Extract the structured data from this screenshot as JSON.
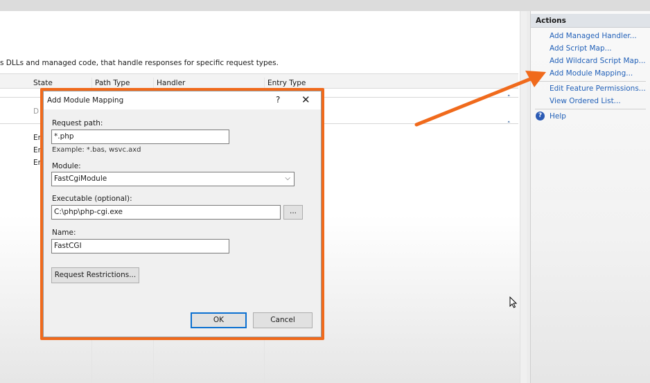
{
  "main": {
    "description": "s DLLs and managed code, that handle responses for specific request types.",
    "columns": [
      "State",
      "Path Type",
      "Handler",
      "Entry Type"
    ],
    "faded_row": "D",
    "rows": [
      "Er",
      "Er",
      "Er"
    ]
  },
  "actions": {
    "title": "Actions",
    "items": [
      "Add Managed Handler...",
      "Add Script Map...",
      "Add Wildcard Script Map...",
      "Add Module Mapping...",
      "Edit Feature Permissions...",
      "View Ordered List...",
      "Help"
    ]
  },
  "dialog": {
    "title": "Add Module Mapping",
    "help_glyph": "?",
    "close_glyph": "✕",
    "request_path_label": "Request path:",
    "request_path_value": "*.php",
    "request_path_hint": "Example: *.bas, wsvc.axd",
    "module_label": "Module:",
    "module_value": "FastCgiModule",
    "executable_label": "Executable (optional):",
    "executable_value": "C:\\php\\php-cgi.exe",
    "browse_label": "...",
    "name_label": "Name:",
    "name_value": "FastCGI",
    "restrictions_label": "Request Restrictions...",
    "ok_label": "OK",
    "cancel_label": "Cancel"
  },
  "colors": {
    "highlight": "#f06a1c",
    "link": "#2160b8"
  },
  "icons": [
    "help-icon",
    "chevron-up-icon",
    "chevron-down-icon",
    "close-icon",
    "mouse-cursor-icon"
  ]
}
